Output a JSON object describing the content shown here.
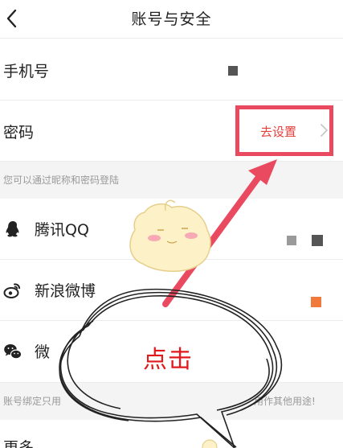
{
  "header": {
    "title": "账号与安全",
    "back_icon": "chevron-left-icon"
  },
  "rows": {
    "phone": {
      "label": "手机号"
    },
    "password": {
      "label": "密码",
      "action": "去设置",
      "chevron_icon": "chevron-right-icon"
    }
  },
  "hints": {
    "login": "您可以通过昵称和密码登陆",
    "bind_left": "账号绑定只用",
    "bind_right": "用作其他用途!"
  },
  "accounts": [
    {
      "label": "腾讯QQ",
      "icon": "qq-icon"
    },
    {
      "label": "新浪微博",
      "icon": "weibo-icon"
    },
    {
      "label": "微",
      "icon": "wechat-icon"
    }
  ],
  "more": {
    "label": "更多"
  },
  "annotation": {
    "text": "点击",
    "color": "#e0191d",
    "highlight_color": "#ea4a5f"
  },
  "colors": {
    "accent": "#e4403c",
    "orange_square": "#f07a3c"
  }
}
